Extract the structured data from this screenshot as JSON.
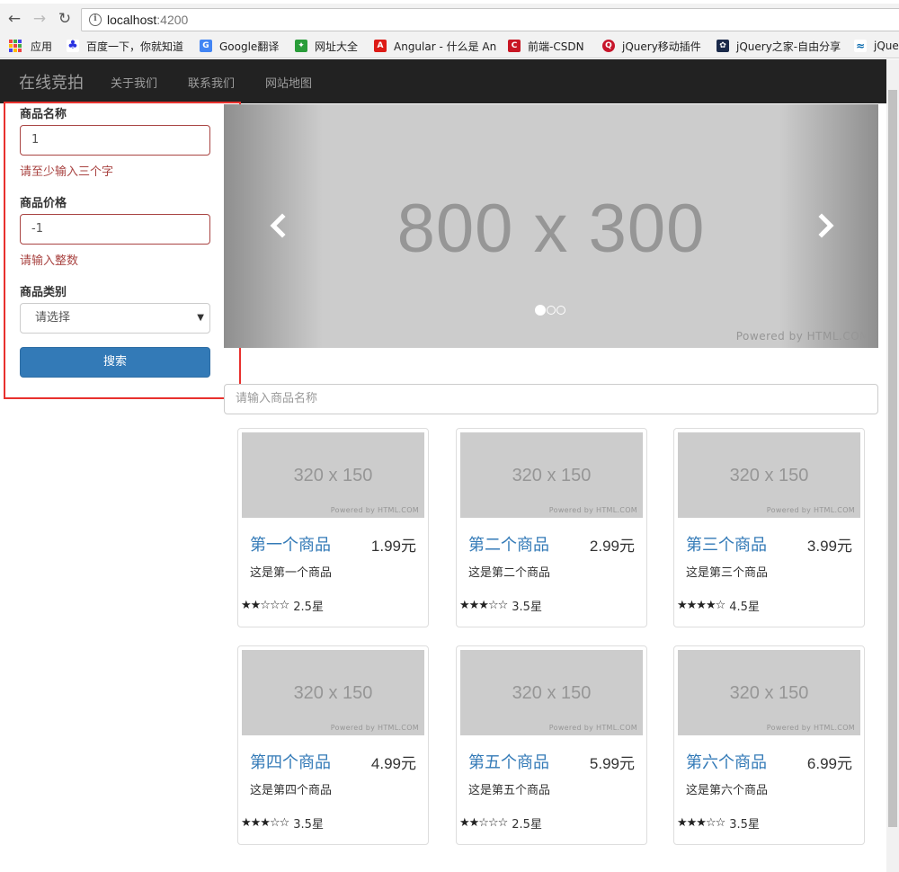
{
  "browser": {
    "url_host": "localhost",
    "url_port": ":4200",
    "bookmarks": [
      {
        "label": "应用",
        "icon": "apps-grid-icon"
      },
      {
        "label": "百度一下，你就知道",
        "icon": "baidu-paw-icon"
      },
      {
        "label": "Google翻译",
        "icon": "google-translate-icon"
      },
      {
        "label": "网址大全",
        "icon": "site-directory-icon"
      },
      {
        "label": "Angular - 什么是 An",
        "icon": "angular-shield-icon"
      },
      {
        "label": "前端-CSDN",
        "icon": "csdn-icon"
      },
      {
        "label": "jQuery移动插件",
        "icon": "jquery-mobile-icon"
      },
      {
        "label": "jQuery之家-自由分享",
        "icon": "jquery-home-leaf-icon"
      },
      {
        "label": "jQue",
        "icon": "jquery-swirl-icon"
      }
    ]
  },
  "nav": {
    "brand": "在线竞拍",
    "links": [
      "关于我们",
      "联系我们",
      "网站地图"
    ]
  },
  "search": {
    "name_label": "商品名称",
    "name_value": "1",
    "name_error": "请至少输入三个字",
    "price_label": "商品价格",
    "price_value": "-1",
    "price_error": "请输入整数",
    "category_label": "商品类别",
    "category_selected": "请选择",
    "submit_label": "搜索"
  },
  "carousel": {
    "placeholder_text": "800 x 300",
    "powered_by": "Powered by HTML.COM",
    "slide_count": 3,
    "active_slide": 1
  },
  "filter": {
    "placeholder": "请输入商品名称"
  },
  "products": [
    {
      "image_text": "320 x 150",
      "powered_by": "Powered by HTML.COM",
      "title": "第一个商品",
      "price": "1.99元",
      "desc": "这是第一个商品",
      "stars": "★★☆☆☆",
      "rating": "2.5星",
      "rating_value": 2.5
    },
    {
      "image_text": "320 x 150",
      "powered_by": "Powered by HTML.COM",
      "title": "第二个商品",
      "price": "2.99元",
      "desc": "这是第二个商品",
      "stars": "★★★☆☆",
      "rating": "3.5星",
      "rating_value": 3.5
    },
    {
      "image_text": "320 x 150",
      "powered_by": "Powered by HTML.COM",
      "title": "第三个商品",
      "price": "3.99元",
      "desc": "这是第三个商品",
      "stars": "★★★★☆",
      "rating": "4.5星",
      "rating_value": 4.5
    },
    {
      "image_text": "320 x 150",
      "powered_by": "Powered by HTML.COM",
      "title": "第四个商品",
      "price": "4.99元",
      "desc": "这是第四个商品",
      "stars": "★★★☆☆",
      "rating": "3.5星",
      "rating_value": 3.5
    },
    {
      "image_text": "320 x 150",
      "powered_by": "Powered by HTML.COM",
      "title": "第五个商品",
      "price": "5.99元",
      "desc": "这是第五个商品",
      "stars": "★★☆☆☆",
      "rating": "2.5星",
      "rating_value": 2.5
    },
    {
      "image_text": "320 x 150",
      "powered_by": "Powered by HTML.COM",
      "title": "第六个商品",
      "price": "6.99元",
      "desc": "这是第六个商品",
      "stars": "★★★☆☆",
      "rating": "3.5星",
      "rating_value": 3.5
    }
  ],
  "colors": {
    "navbar_bg": "#222222",
    "primary": "#337ab7",
    "error": "#a94442",
    "highlight_box": "#e8312e",
    "placeholder_gray": "#cccccc"
  }
}
